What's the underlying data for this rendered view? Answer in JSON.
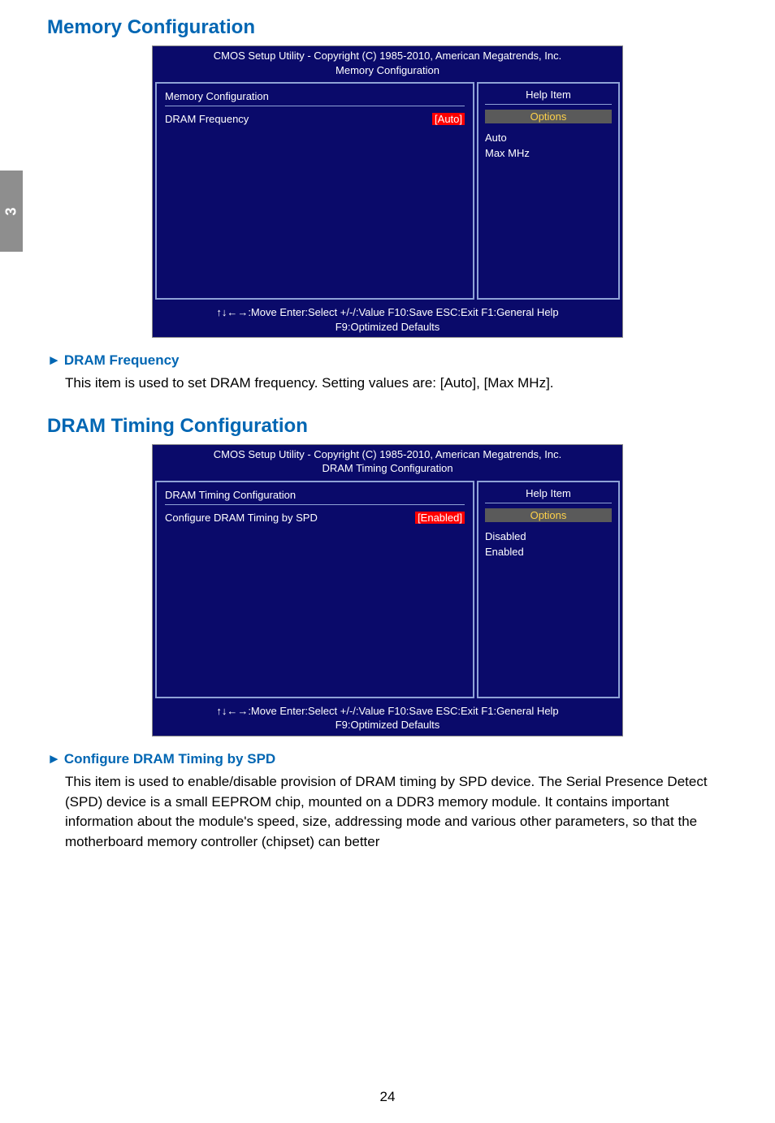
{
  "sidebar_tab": "3",
  "section1": {
    "heading": "Memory Configuration",
    "bios": {
      "header_line1": "CMOS Setup Utility - Copyright (C) 1985-2010, American Megatrends, Inc.",
      "header_line2": "Memory Configuration",
      "left_panel_title": "Memory Configuration",
      "row_label": "DRAM Frequency",
      "row_value": "[Auto]",
      "help_title": "Help Item",
      "options_label": "Options",
      "option1": "Auto",
      "option2": "Max MHz",
      "footer_line1": "↑↓←→:Move   Enter:Select    +/-/:Value    F10:Save     ESC:Exit    F1:General Help",
      "footer_line2": "F9:Optimized Defaults"
    },
    "item_heading": "DRAM Frequency",
    "item_desc": "This item is used to set DRAM frequency. Setting values are: [Auto], [Max MHz]."
  },
  "section2": {
    "heading": "DRAM Timing Configuration",
    "bios": {
      "header_line1": "CMOS Setup Utility - Copyright (C) 1985-2010, American Megatrends, Inc.",
      "header_line2": "DRAM Timing Configuration",
      "left_panel_title": "DRAM Timing Configuration",
      "row_label": "Configure DRAM Timing by SPD",
      "row_value": "[Enabled]",
      "help_title": "Help Item",
      "options_label": "Options",
      "option1": "Disabled",
      "option2": "Enabled",
      "footer_line1": "↑↓←→:Move   Enter:Select    +/-/:Value    F10:Save     ESC:Exit    F1:General Help",
      "footer_line2": "F9:Optimized Defaults"
    },
    "item_heading": "Configure DRAM Timing by SPD",
    "item_desc": "This item is used to enable/disable provision of DRAM timing by SPD device. The Serial Presence Detect (SPD) device is a small EEPROM chip, mounted on a DDR3 memory module. It contains important information about the module's speed, size, addressing mode and various other parameters, so that the motherboard memory controller (chipset) can better"
  },
  "page_number": "24",
  "triangle": "►"
}
